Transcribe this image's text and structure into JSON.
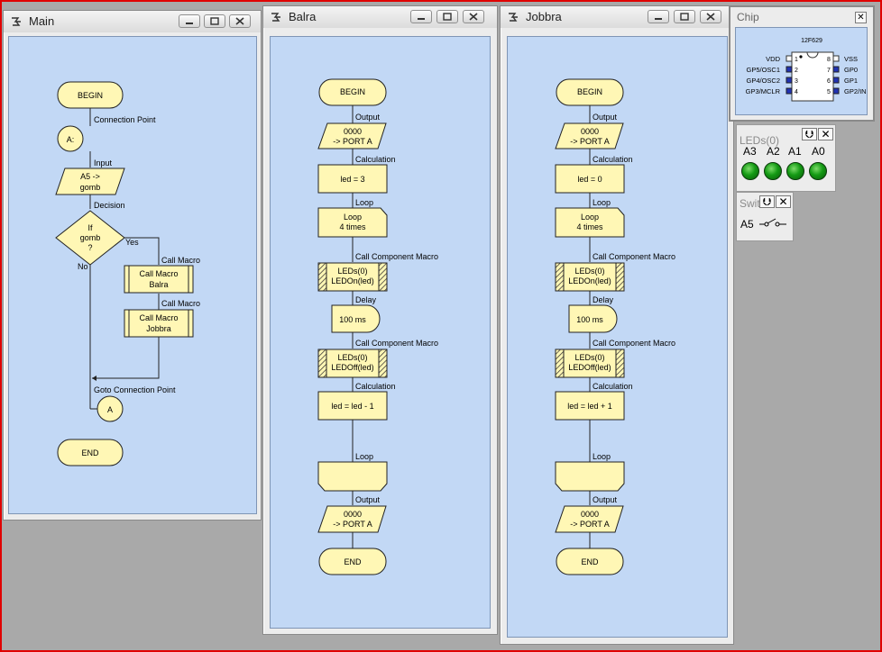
{
  "windows": {
    "main": {
      "title": "Main"
    },
    "balra": {
      "title": "Balra"
    },
    "jobbra": {
      "title": "Jobbra"
    }
  },
  "main_flow": {
    "begin": "BEGIN",
    "connection_point_label": "Connection Point",
    "connection_point": "A:",
    "input_label": "Input",
    "input_line1": "A5 ->",
    "input_line2": "gomb",
    "decision_label": "Decision",
    "decision_line1": "If",
    "decision_line2": "gomb",
    "decision_line3": "?",
    "yes": "Yes",
    "no": "No",
    "call_macro_label_1": "Call Macro",
    "call_macro_1_line1": "Call Macro",
    "call_macro_1_line2": "Balra",
    "call_macro_label_2": "Call Macro",
    "call_macro_2_line1": "Call Macro",
    "call_macro_2_line2": "Jobbra",
    "goto_label": "Goto Connection Point",
    "goto_target": "A",
    "end": "END"
  },
  "balra_flow": {
    "begin": "BEGIN",
    "output_label_1": "Output",
    "output_1_line1": "0000",
    "output_1_line2": "-> PORT A",
    "calc_label_1": "Calculation",
    "calc_1": "led = 3",
    "loop_label_1": "Loop",
    "loop_line1": "Loop",
    "loop_line2": "4 times",
    "component_label_1": "Call Component Macro",
    "component_1_line1": "LEDs(0)",
    "component_1_line2": "LEDOn(led)",
    "delay_label": "Delay",
    "delay": "100 ms",
    "component_label_2": "Call Component Macro",
    "component_2_line1": "LEDs(0)",
    "component_2_line2": "LEDOff(led)",
    "calc_label_2": "Calculation",
    "calc_2": "led = led - 1",
    "loop_label_2": "Loop",
    "output_label_2": "Output",
    "output_2_line1": "0000",
    "output_2_line2": "-> PORT A",
    "end": "END"
  },
  "jobbra_flow": {
    "begin": "BEGIN",
    "output_label_1": "Output",
    "output_1_line1": "0000",
    "output_1_line2": "-> PORT A",
    "calc_label_1": "Calculation",
    "calc_1": "led = 0",
    "loop_label_1": "Loop",
    "loop_line1": "Loop",
    "loop_line2": "4 times",
    "component_label_1": "Call Component Macro",
    "component_1_line1": "LEDs(0)",
    "component_1_line2": "LEDOn(led)",
    "delay_label": "Delay",
    "delay": "100 ms",
    "component_label_2": "Call Component Macro",
    "component_2_line1": "LEDs(0)",
    "component_2_line2": "LEDOff(led)",
    "calc_label_2": "Calculation",
    "calc_2": "led = led + 1",
    "loop_label_2": "Loop",
    "output_label_2": "Output",
    "output_2_line1": "0000",
    "output_2_line2": "-> PORT A",
    "end": "END"
  },
  "chip": {
    "title": "Chip",
    "model": "12F629",
    "left_pins": [
      {
        "name": "VDD",
        "num": "1"
      },
      {
        "name": "GP5/OSC1",
        "num": "2"
      },
      {
        "name": "GP4/OSC2",
        "num": "3"
      },
      {
        "name": "GP3/MCLR",
        "num": "4"
      }
    ],
    "right_pins": [
      {
        "name": "VSS",
        "num": "8"
      },
      {
        "name": "GP0",
        "num": "7"
      },
      {
        "name": "GP1",
        "num": "6"
      },
      {
        "name": "GP2/IN",
        "num": "5"
      }
    ]
  },
  "leds_panel": {
    "title": "LEDs(0)",
    "labels": [
      "A3",
      "A2",
      "A1",
      "A0"
    ],
    "led_color": "#149a14"
  },
  "switch_panel": {
    "title": "Swit",
    "label": "A5"
  },
  "colors": {
    "canvas_bg": "#c2d8f5",
    "shape_fill": "#fff7b5",
    "frame": "#e00000"
  }
}
